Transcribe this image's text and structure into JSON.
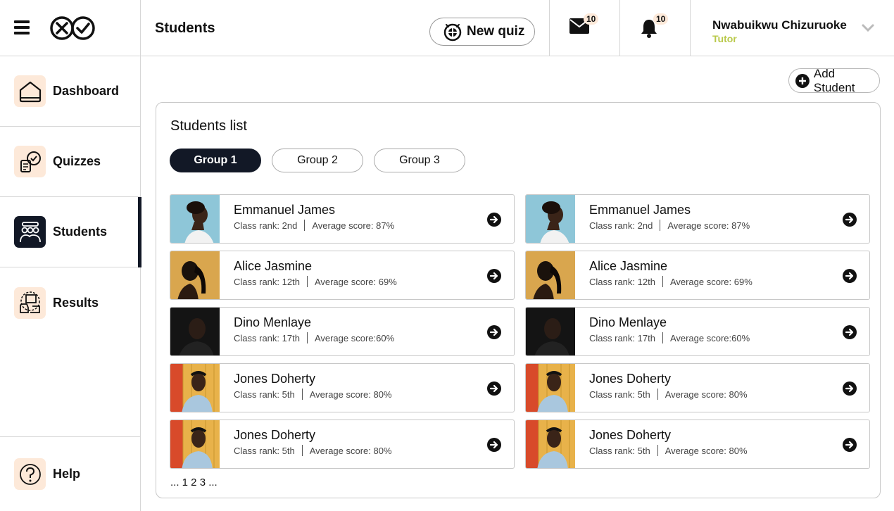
{
  "header": {
    "page_title": "Students",
    "new_quiz_label": "New quiz",
    "mail_count": "10",
    "notification_count": "10",
    "user_name": "Nwabuikwu Chizuruoke",
    "user_role": "Tutor"
  },
  "sidebar": {
    "items": [
      {
        "label": "Dashboard",
        "icon": "home-icon"
      },
      {
        "label": "Quizzes",
        "icon": "quiz-icon"
      },
      {
        "label": "Students",
        "icon": "students-icon",
        "active": true
      },
      {
        "label": "Results",
        "icon": "results-icon"
      }
    ],
    "help_label": "Help"
  },
  "main": {
    "add_student_label": "Add Student",
    "list_title": "Students list",
    "groups": [
      "Group 1",
      "Group 2",
      "Group 3"
    ],
    "active_group": "Group 1",
    "students": [
      {
        "name": "Emmanuel James",
        "rank": "Class rank: 2nd",
        "score": "Average score: 87%"
      },
      {
        "name": "Alice Jasmine",
        "rank": "Class rank: 12th",
        "score": "Average score: 69%"
      },
      {
        "name": "Dino Menlaye",
        "rank": "Class rank: 17th",
        "score": "Average score:60%"
      },
      {
        "name": "Jones Doherty",
        "rank": "Class rank: 5th",
        "score": "Average score: 80%"
      },
      {
        "name": "Jones Doherty",
        "rank": "Class rank: 5th",
        "score": "Average score: 80%"
      }
    ],
    "pagination": "... 1 2 3 ..."
  },
  "colors": {
    "dark": "#121826",
    "accent_peach": "#fde9d9",
    "role_green": "#b9c94a"
  }
}
